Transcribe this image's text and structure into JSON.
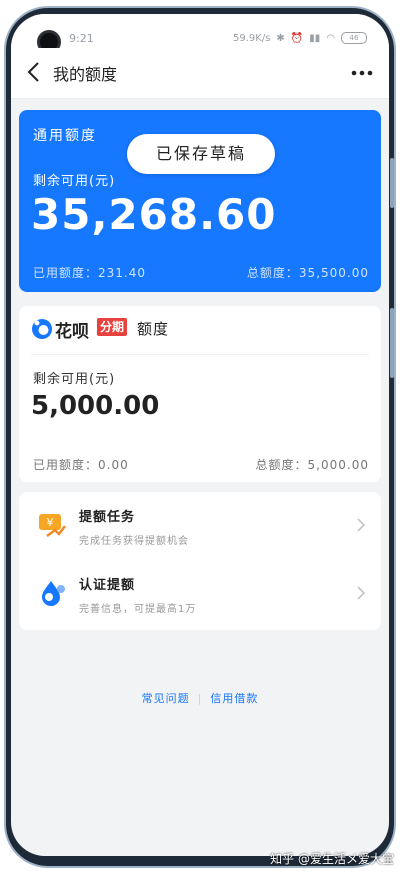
{
  "status_bar": {
    "time": "9:21",
    "network_speed": "59.9K/s",
    "battery": "46"
  },
  "nav": {
    "title": "我的额度"
  },
  "general_quota": {
    "title": "通用额度",
    "toast": "已保存草稿",
    "remaining_label": "剩余可用(元)",
    "remaining_amount": "35,268.60",
    "used_text": "已用额度：231.40",
    "total_text": "总额度：35,500.00"
  },
  "huabei_quota": {
    "brand": "花呗",
    "tag": "分期",
    "label": "额度",
    "remaining_label": "剩余可用(元)",
    "remaining_amount": "5,000.00",
    "used_text": "已用额度：0.00",
    "total_text": "总额度：5,000.00"
  },
  "tasks": [
    {
      "title": "提额任务",
      "desc": "完成任务获得提额机会",
      "icon": "coin-task-icon"
    },
    {
      "title": "认证提额",
      "desc": "完善信息，可提最高1万",
      "icon": "verify-drop-icon"
    }
  ],
  "footer": {
    "faq": "常见问题",
    "separator": "|",
    "credit_loan": "信用借款"
  },
  "watermark": "知乎 @爱生活メ爱大宝",
  "colors": {
    "accent": "#1677ff",
    "huabei_red": "#e8413e",
    "page_bg": "#f2f3f5"
  }
}
